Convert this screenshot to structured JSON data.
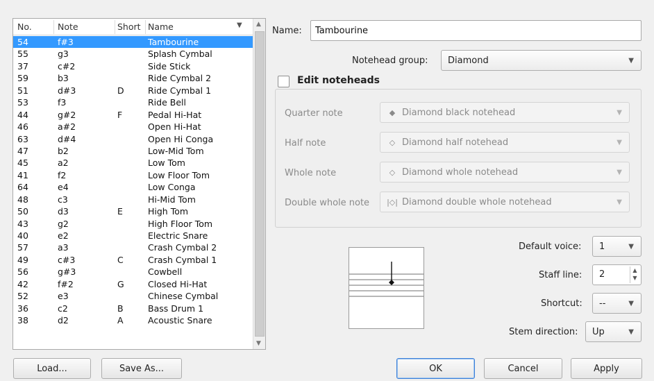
{
  "table": {
    "columns": [
      "No.",
      "Note",
      "Short",
      "Name"
    ],
    "rows": [
      {
        "no": "54",
        "note": "f#3",
        "short": "",
        "name": "Tambourine"
      },
      {
        "no": "55",
        "note": "g3",
        "short": "",
        "name": "Splash Cymbal"
      },
      {
        "no": "37",
        "note": "c#2",
        "short": "",
        "name": "Side Stick"
      },
      {
        "no": "59",
        "note": "b3",
        "short": "",
        "name": "Ride Cymbal 2"
      },
      {
        "no": "51",
        "note": "d#3",
        "short": "D",
        "name": "Ride Cymbal 1"
      },
      {
        "no": "53",
        "note": "f3",
        "short": "",
        "name": "Ride Bell"
      },
      {
        "no": "44",
        "note": "g#2",
        "short": "F",
        "name": "Pedal Hi-Hat"
      },
      {
        "no": "46",
        "note": "a#2",
        "short": "",
        "name": "Open Hi-Hat"
      },
      {
        "no": "63",
        "note": "d#4",
        "short": "",
        "name": "Open Hi Conga"
      },
      {
        "no": "47",
        "note": "b2",
        "short": "",
        "name": "Low-Mid Tom"
      },
      {
        "no": "45",
        "note": "a2",
        "short": "",
        "name": "Low Tom"
      },
      {
        "no": "41",
        "note": "f2",
        "short": "",
        "name": "Low Floor Tom"
      },
      {
        "no": "64",
        "note": "e4",
        "short": "",
        "name": "Low Conga"
      },
      {
        "no": "48",
        "note": "c3",
        "short": "",
        "name": "Hi-Mid Tom"
      },
      {
        "no": "50",
        "note": "d3",
        "short": "E",
        "name": "High Tom"
      },
      {
        "no": "43",
        "note": "g2",
        "short": "",
        "name": "High Floor Tom"
      },
      {
        "no": "40",
        "note": "e2",
        "short": "",
        "name": "Electric Snare"
      },
      {
        "no": "57",
        "note": "a3",
        "short": "",
        "name": "Crash Cymbal 2"
      },
      {
        "no": "49",
        "note": "c#3",
        "short": "C",
        "name": "Crash Cymbal 1"
      },
      {
        "no": "56",
        "note": "g#3",
        "short": "",
        "name": "Cowbell"
      },
      {
        "no": "42",
        "note": "f#2",
        "short": "G",
        "name": "Closed Hi-Hat"
      },
      {
        "no": "52",
        "note": "e3",
        "short": "",
        "name": "Chinese Cymbal"
      },
      {
        "no": "36",
        "note": "c2",
        "short": "B",
        "name": "Bass Drum 1"
      },
      {
        "no": "38",
        "note": "d2",
        "short": "A",
        "name": "Acoustic Snare"
      }
    ],
    "selected_index": 0
  },
  "buttons": {
    "load": "Load...",
    "save_as": "Save As...",
    "ok": "OK",
    "cancel": "Cancel",
    "apply": "Apply"
  },
  "name_field": {
    "label": "Name:",
    "value": "Tambourine"
  },
  "notehead_group": {
    "label": "Notehead group:",
    "value": "Diamond"
  },
  "edit_noteheads": {
    "label": "Edit noteheads",
    "checked": false
  },
  "noteheads": [
    {
      "label": "Quarter note",
      "value": "Diamond black notehead",
      "glyph": "◆"
    },
    {
      "label": "Half note",
      "value": "Diamond half notehead",
      "glyph": "◇"
    },
    {
      "label": "Whole note",
      "value": "Diamond whole notehead",
      "glyph": "◇"
    },
    {
      "label": "Double whole note",
      "value": "Diamond double whole notehead",
      "glyph": "|◇|"
    }
  ],
  "default_voice": {
    "label": "Default voice:",
    "value": "1"
  },
  "staff_line": {
    "label": "Staff line:",
    "value": "2"
  },
  "shortcut": {
    "label": "Shortcut:",
    "value": "--"
  },
  "stem_direction": {
    "label": "Stem direction:",
    "value": "Up"
  },
  "colors": {
    "selection": "#3399ff",
    "background": "#f0f0f0"
  }
}
